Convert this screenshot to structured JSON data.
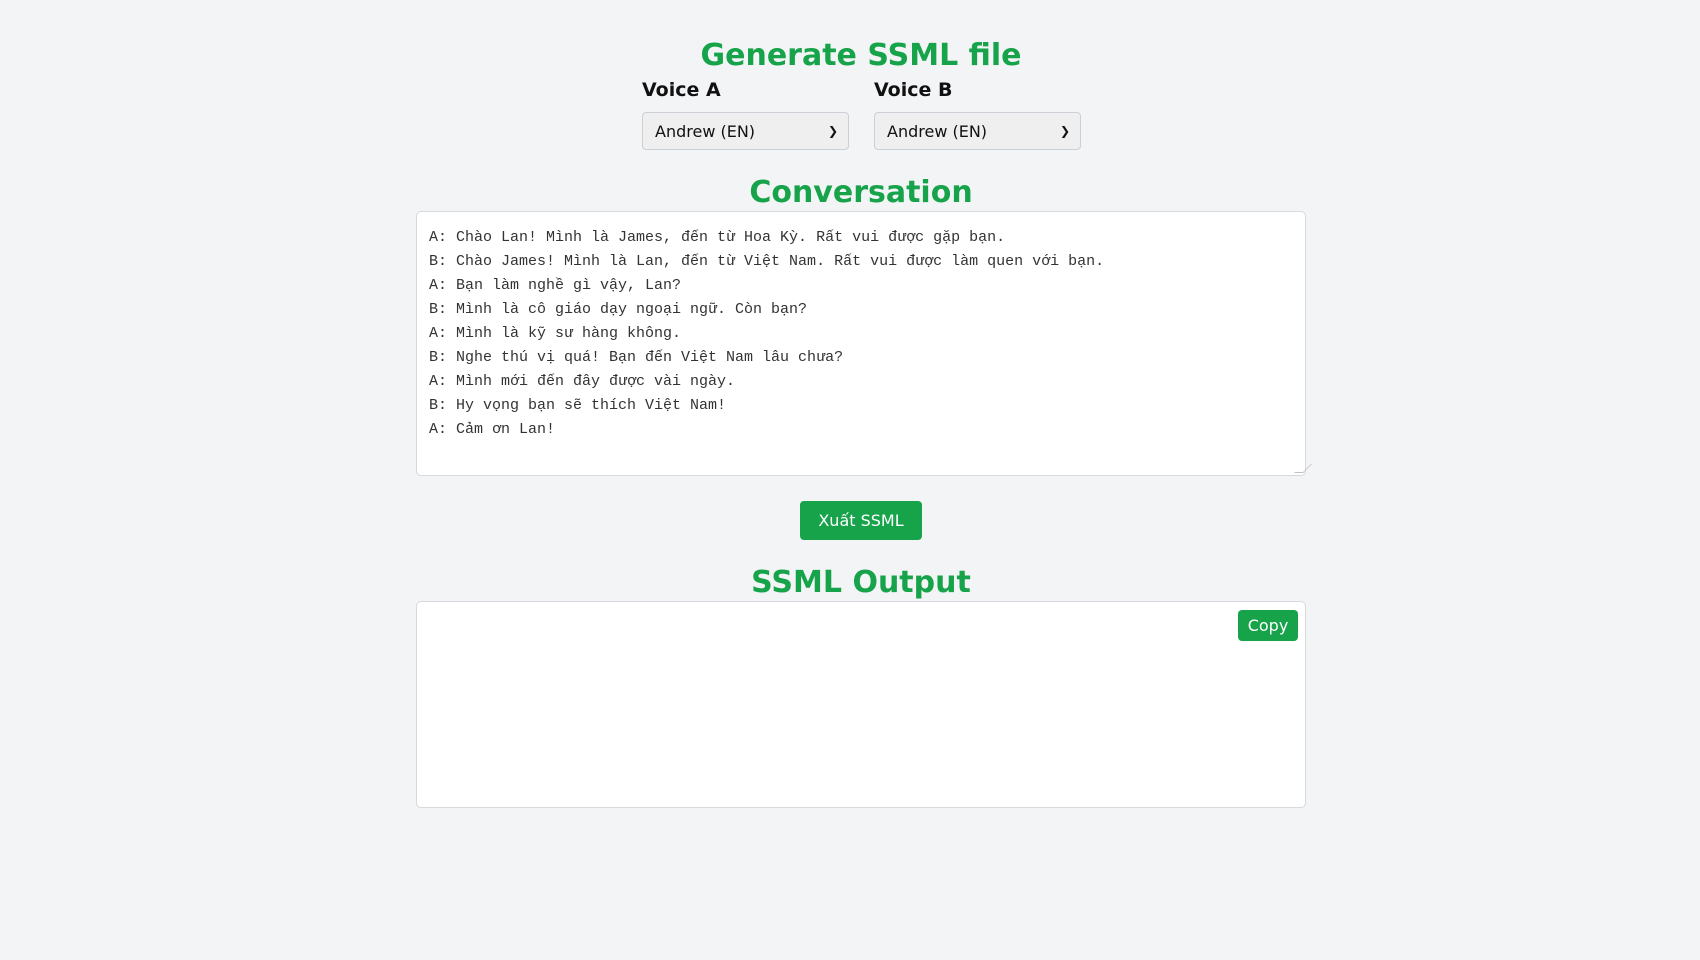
{
  "header": {
    "title": "Generate SSML file"
  },
  "voices": [
    {
      "label": "Voice A",
      "selected": "Andrew (EN)"
    },
    {
      "label": "Voice B",
      "selected": "Andrew (EN)"
    }
  ],
  "conversation": {
    "heading": "Conversation",
    "lines": [
      "A: Chào Lan! Mình là James, đến từ Hoa Kỳ. Rất vui được gặp bạn.",
      "B: Chào James! Mình là Lan, đến từ Việt Nam. Rất vui được làm quen với bạn.",
      "A: Bạn làm nghề gì vậy, Lan?",
      "B: Mình là cô giáo dạy ngoại ngữ. Còn bạn?",
      "A: Mình là kỹ sư hàng không.",
      "B: Nghe thú vị quá! Bạn đến Việt Nam lâu chưa?",
      "A: Mình mới đến đây được vài ngày.",
      "B: Hy vọng bạn sẽ thích Việt Nam!",
      "A: Cảm ơn Lan!"
    ]
  },
  "export_button": "Xuất SSML",
  "output": {
    "heading": "SSML Output",
    "copy_button": "Copy",
    "value": ""
  },
  "colors": {
    "accent": "#16a34a",
    "background": "#f3f4f6"
  }
}
